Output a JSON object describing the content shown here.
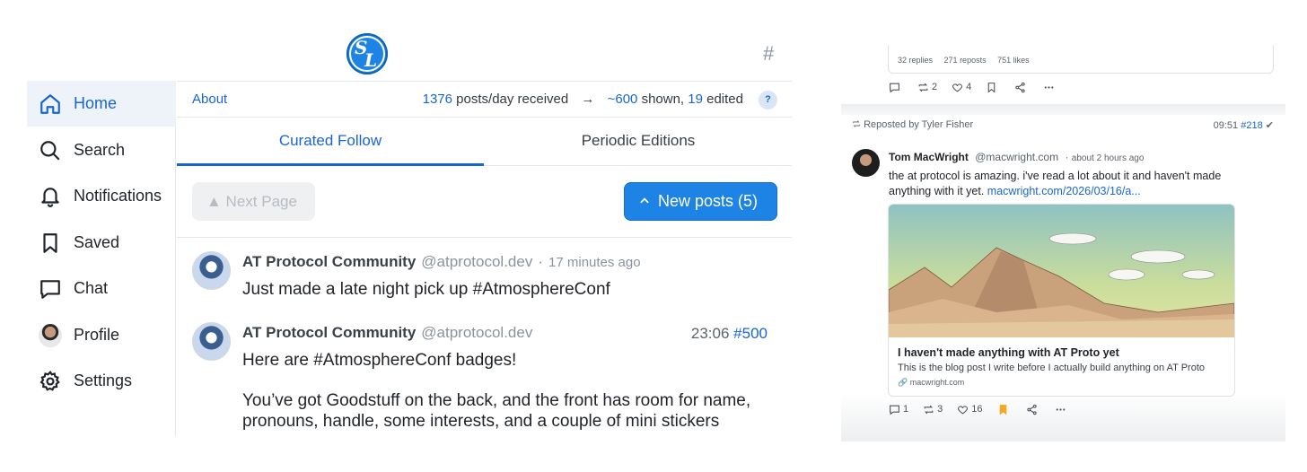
{
  "sidebar": {
    "items": [
      {
        "label": "Home",
        "icon": "home-icon",
        "active": true
      },
      {
        "label": "Search",
        "icon": "search-icon"
      },
      {
        "label": "Notifications",
        "icon": "bell-icon"
      },
      {
        "label": "Saved",
        "icon": "bookmark-icon"
      },
      {
        "label": "Chat",
        "icon": "chat-icon"
      },
      {
        "label": "Profile",
        "icon": "avatar"
      },
      {
        "label": "Settings",
        "icon": "gear-icon"
      }
    ]
  },
  "header": {
    "hash": "#",
    "about": "About",
    "received_count": "1376",
    "received_label": "posts/day received",
    "arrow": "→",
    "shown_count": "~600",
    "shown_label": "shown,",
    "edited_count": "19",
    "edited_label": "edited",
    "help": "?"
  },
  "tabs": [
    {
      "label": "Curated Follow",
      "active": true
    },
    {
      "label": "Periodic Editions",
      "active": false
    }
  ],
  "buttons": {
    "next_page": "▲ Next Page",
    "new_posts": "New posts (5)"
  },
  "posts": [
    {
      "name": "AT Protocol Community",
      "handle": "@atprotocol.dev",
      "dot": "·",
      "time": "17 minutes ago",
      "text": "Just made a late night pick up #AtmosphereConf"
    },
    {
      "name": "AT Protocol Community",
      "handle": "@atprotocol.dev",
      "time": "23:06",
      "number": "#500",
      "text1": "Here are #AtmosphereConf badges!",
      "text2": "You’ve got Goodstuff on the back, and the front has room for name,",
      "text3": "pronouns, handle, some interests, and a couple of mini stickers"
    }
  ],
  "right": {
    "top_counts": {
      "replies": "32 replies",
      "reposts": "271 reposts",
      "likes": "751 likes"
    },
    "top_actions": {
      "reposts": "2",
      "likes": "4"
    },
    "repost_line": "Reposted by Tyler Fisher",
    "time": "09:51",
    "number": "#218",
    "check": "✔",
    "author_name": "Tom MacWright",
    "author_handle": "@macwright.com",
    "dot": "·",
    "author_time": "about 2 hours ago",
    "text": "the at protocol is amazing. i've read a lot about it and haven't made anything with it yet.",
    "link": "macwright.com/2026/03/16/a...",
    "card_title": "I haven't made anything with AT Proto yet",
    "card_desc": "This is the blog post I write before I actually build anything on AT Proto",
    "card_domain": "macwright.com",
    "actions": {
      "replies": "1",
      "reposts": "3",
      "likes": "16"
    }
  },
  "colors": {
    "accent": "#1866d0",
    "button": "#1d84e6",
    "bookmark": "#f5a623"
  }
}
